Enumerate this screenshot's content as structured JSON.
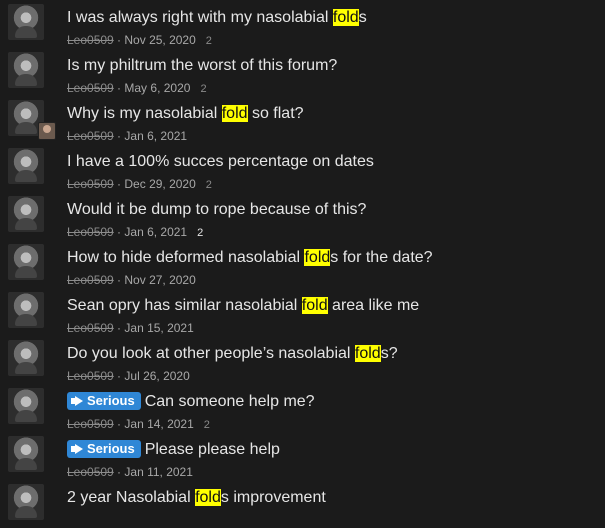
{
  "threads": [
    {
      "title_parts": [
        "I was always right with my nasolabial ",
        "fold",
        "s"
      ],
      "author": "Leo0509",
      "date": "Nov 25, 2020",
      "replies": "2"
    },
    {
      "title_parts": [
        "Is my philtrum the worst of this forum?",
        "",
        ""
      ],
      "author": "Leo0509",
      "date": "May 6, 2020",
      "replies": "2"
    },
    {
      "title_parts": [
        "Why is my nasolabial ",
        "fold",
        " so flat?"
      ],
      "author": "Leo0509",
      "date": "Jan 6, 2021",
      "replies": ""
    },
    {
      "title_parts": [
        "I have a 100% succes percentage on dates",
        "",
        ""
      ],
      "author": "Leo0509",
      "date": "Dec 29, 2020",
      "replies": "2"
    },
    {
      "title_parts": [
        "Would it be dump to rope because of this?",
        "",
        ""
      ],
      "author": "Leo0509",
      "date": "Jan 6, 2021",
      "replies": "2"
    },
    {
      "title_parts": [
        "How to hide deformed nasolabial ",
        "fold",
        "s for the date?"
      ],
      "author": "Leo0509",
      "date": "Nov 27, 2020",
      "replies": ""
    },
    {
      "title_parts": [
        "Sean opry has similar nasolabial ",
        "fold",
        " area like me"
      ],
      "author": "Leo0509",
      "date": "Jan 15, 2021",
      "replies": ""
    },
    {
      "title_parts": [
        "Do you look at other people’s nasolabial ",
        "fold",
        "s?"
      ],
      "author": "Leo0509",
      "date": "Jul 26, 2020",
      "replies": ""
    },
    {
      "badge": "Serious",
      "title_parts": [
        "Can someone help me?",
        "",
        ""
      ],
      "author": "Leo0509",
      "date": "Jan 14, 2021",
      "replies": "2"
    },
    {
      "badge": "Serious",
      "title_parts": [
        "Please please help",
        "",
        ""
      ],
      "author": "Leo0509",
      "date": "Jan 11, 2021",
      "replies": ""
    },
    {
      "title_parts": [
        "2 year Nasolabial ",
        "fold",
        "s improvement"
      ],
      "author": "",
      "date": "",
      "replies": ""
    }
  ],
  "meta_separator": " · ",
  "highlight_color": "#ffff00",
  "badge_color": "#2f87d6",
  "icons": {
    "avatar": "user-avatar",
    "badge": "megaphone-icon"
  }
}
